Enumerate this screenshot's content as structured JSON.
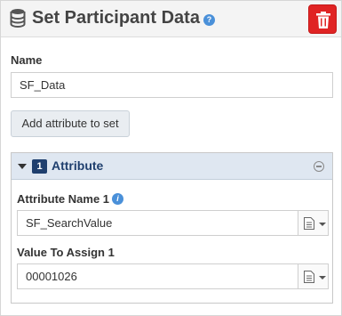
{
  "header": {
    "title": "Set Participant Data",
    "help_icon": "?",
    "delete_icon": "trash-icon",
    "accent": "#e02424"
  },
  "name_field": {
    "label": "Name",
    "value": "SF_Data"
  },
  "add_attribute_label": "Add attribute to set",
  "attribute": {
    "index": "1",
    "title": "Attribute",
    "name_label": "Attribute Name 1",
    "name_value": "SF_SearchValue",
    "value_label": "Value To Assign 1",
    "value_value": "00001026",
    "info_icon": "i"
  }
}
